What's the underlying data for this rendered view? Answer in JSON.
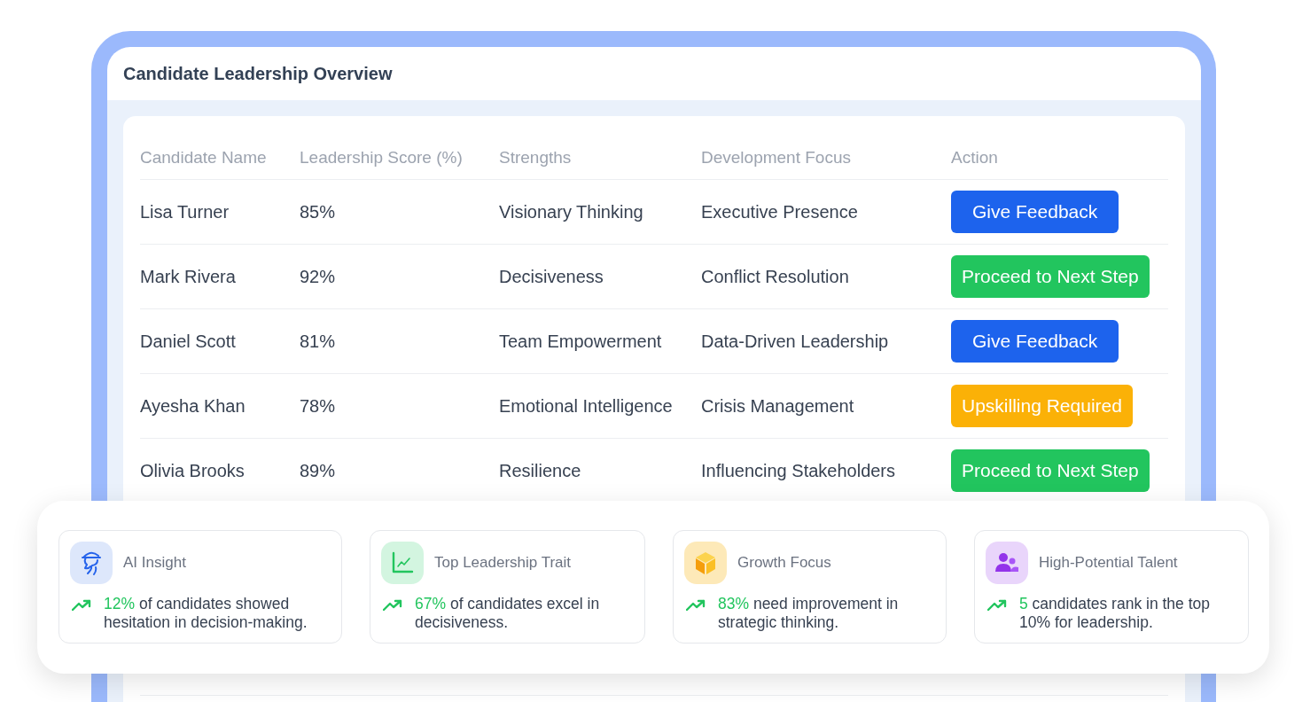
{
  "window": {
    "title": "Candidate Leadership Overview"
  },
  "table": {
    "columns": [
      "Candidate Name",
      "Leadership Score (%)",
      "Strengths",
      "Development Focus",
      "Action"
    ],
    "rows": [
      {
        "name": "Lisa Turner",
        "score": "85%",
        "strength": "Visionary Thinking",
        "focus": "Executive Presence",
        "action": {
          "label": "Give Feedback",
          "kind": "feedback"
        }
      },
      {
        "name": "Mark Rivera",
        "score": "92%",
        "strength": "Decisiveness",
        "focus": "Conflict Resolution",
        "action": {
          "label": "Proceed to Next Step",
          "kind": "proceed"
        }
      },
      {
        "name": "Daniel Scott",
        "score": "81%",
        "strength": "Team Empowerment",
        "focus": "Data-Driven Leadership",
        "action": {
          "label": "Give Feedback",
          "kind": "feedback"
        }
      },
      {
        "name": "Ayesha Khan",
        "score": "78%",
        "strength": "Emotional Intelligence",
        "focus": "Crisis Management",
        "action": {
          "label": "Upskilling Required",
          "kind": "upskill"
        }
      },
      {
        "name": "Olivia Brooks",
        "score": "89%",
        "strength": "Resilience",
        "focus": "Influencing Stakeholders",
        "action": {
          "label": "Proceed to Next Step",
          "kind": "proceed"
        }
      }
    ]
  },
  "insights": [
    {
      "kind": "ai",
      "title": "AI Insight",
      "highlight": "12%",
      "text": "of candidates showed hesitation in decision-making."
    },
    {
      "kind": "trait",
      "title": "Top Leadership Trait",
      "highlight": "67%",
      "text": "of candidates excel in decisiveness."
    },
    {
      "kind": "growth",
      "title": "Growth Focus",
      "highlight": "83%",
      "text": "need improvement in strategic thinking."
    },
    {
      "kind": "talent",
      "title": "High-Potential Talent",
      "highlight": "5",
      "text": "candidates rank in the top 10% for leadership."
    }
  ]
}
